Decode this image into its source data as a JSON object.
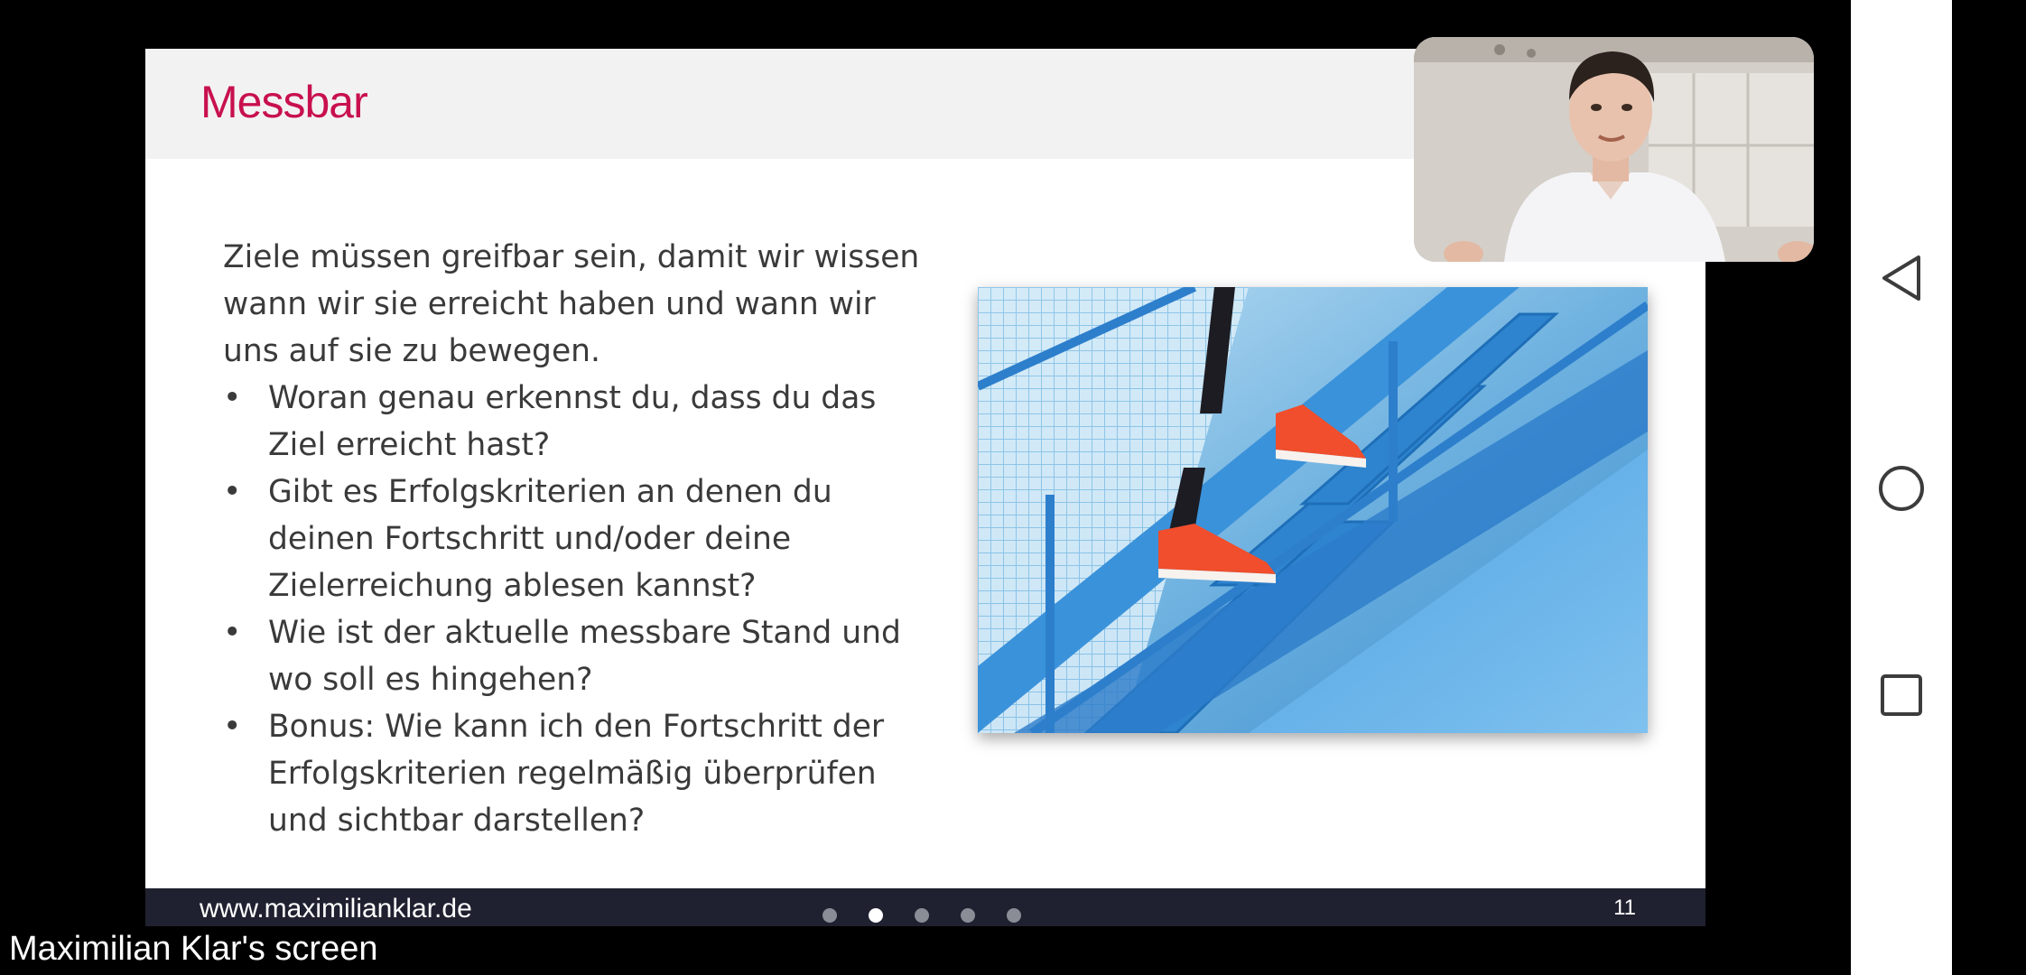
{
  "slide": {
    "title": "Messbar",
    "intro": "Ziele müssen greifbar sein, damit wir wissen wann wir sie erreicht haben und wann wir uns auf sie zu bewegen.",
    "bullets": [
      "Woran genau erkennst du, dass du das Ziel erreicht hast?",
      "Gibt es Erfolgskriterien an denen du deinen Fortschritt und/oder deine Zielerreichung ablesen kannst?",
      "Wie ist der aktuelle messbare Stand und wo soll es hingehen?",
      "Bonus: Wie kann ich den Fortschritt der Erfolgskriterien regelmäßig überprüfen und sichtbar darstellen?"
    ],
    "footer": {
      "url": "www.maximilianklar.de",
      "page_number": "11",
      "pagination_dots": 5,
      "active_dot": 2
    },
    "accent_color": "#c8104f",
    "photo_icon": "stairs-photo"
  },
  "webcam": {
    "icon": "presenter-video"
  },
  "caption": {
    "text": "Maximilian Klar's screen"
  },
  "nav_bar": {
    "back_icon": "back-triangle-icon",
    "home_icon": "home-circle-icon",
    "recents_icon": "recents-square-icon"
  }
}
